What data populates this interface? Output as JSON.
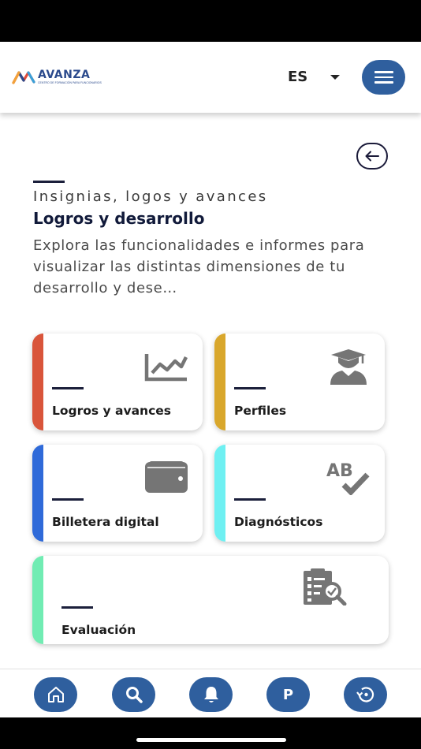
{
  "header": {
    "logo_word": "AVANZA",
    "logo_tagline": "CENTRO DE FORMACIÓN PARA FUNCIONARIOS",
    "language": "ES"
  },
  "section": {
    "overline": "Insignias, logos y avances",
    "title": "Logros y desarrollo",
    "description": "Explora las funcionalidades e informes para visualizar las distintas dimensiones de tu desarrollo y dese…"
  },
  "cards": [
    {
      "label": "Logros y avances",
      "accent": "#d9553b",
      "icon": "trending-chart-icon"
    },
    {
      "label": "Perfiles",
      "accent": "#d9a72c",
      "icon": "graduate-user-icon"
    },
    {
      "label": "Billetera digital",
      "accent": "#2f6ad9",
      "icon": "wallet-icon"
    },
    {
      "label": "Diagnósticos",
      "accent": "#6ff0f2",
      "icon": "spellcheck-icon"
    },
    {
      "label": "Evaluación",
      "accent": "#71ecb3",
      "icon": "clipboard-search-icon"
    }
  ],
  "bottom_nav": {
    "profile_letter": "P"
  },
  "colors": {
    "primary": "#2f5f9e",
    "title": "#111a3a",
    "icon_gray": "#757575"
  }
}
